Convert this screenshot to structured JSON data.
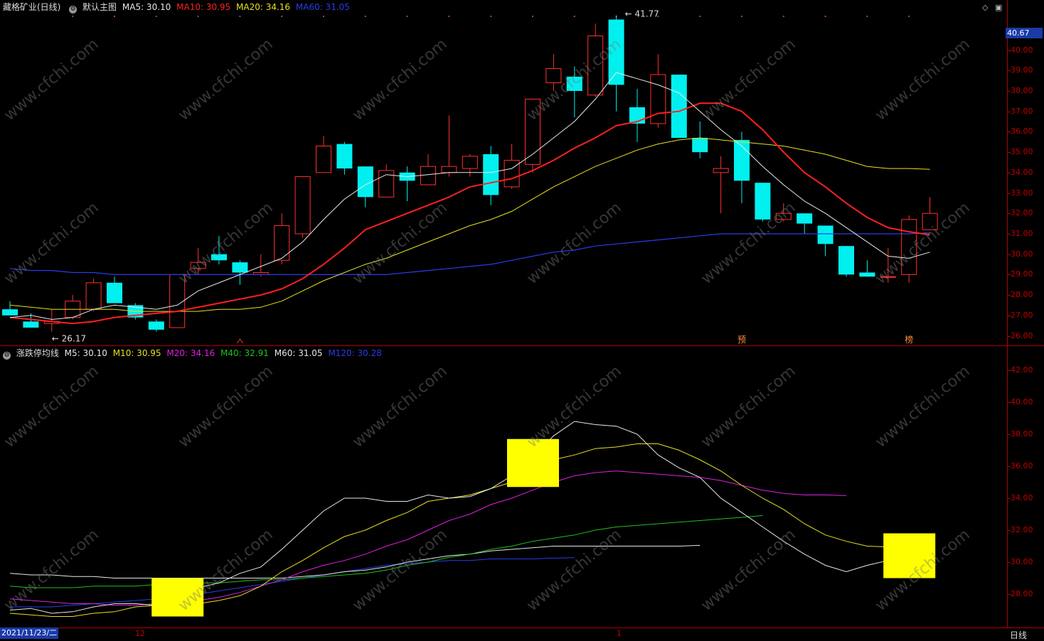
{
  "header_top": {
    "stock": "藏格矿业(日线)",
    "main_label": "默认主图",
    "ma5": "MA5: 30.10",
    "ma10": "MA10: 30.95",
    "ma20": "MA20: 34.16",
    "ma60": "MA60: 31.05"
  },
  "header_bottom": {
    "indicator": "涨跌停均线",
    "m5": "M5: 30.10",
    "m10": "M10: 30.95",
    "m20": "M20: 34.16",
    "m40": "M40: 32.91",
    "m60": "M60: 31.05",
    "m120": "M120: 30.28"
  },
  "colors": {
    "ma5": "#e8e8e8",
    "ma10": "#ff2020",
    "ma20": "#e8e020",
    "ma60": "#2a3ce8",
    "m5": "#e8e8e8",
    "m10": "#e8e020",
    "m20": "#e020e0",
    "m40": "#20c020",
    "m60": "#e8e8e8",
    "m120": "#2a3ce8",
    "up": "#ff3030",
    "down": "#00f0f0",
    "marker": "#ffff00"
  },
  "current_price": "40.67",
  "high_label": "41.77",
  "low_label": "26.17",
  "event_labels": [
    "预",
    "榜"
  ],
  "top_axis_ticks": [
    "40.00",
    "39.00",
    "38.00",
    "37.00",
    "36.00",
    "35.00",
    "34.00",
    "33.00",
    "32.00",
    "31.00",
    "30.00",
    "29.00",
    "28.00",
    "27.00",
    "26.00"
  ],
  "bottom_axis_ticks": [
    "42.00",
    "40.00",
    "38.00",
    "36.00",
    "34.00",
    "32.00",
    "30.00",
    "28.00"
  ],
  "date_bar": {
    "current_date": "2021/11/23/二",
    "month_12": "12",
    "month_1": "1",
    "period": "日线"
  },
  "controls": {
    "diamond": "◇",
    "restore": "▣"
  },
  "watermark": "www.cfchi.com",
  "chart_data": {
    "type": "candlestick",
    "candles": [
      {
        "o": 27.3,
        "h": 27.7,
        "l": 27.0,
        "c": 27.0
      },
      {
        "o": 26.7,
        "h": 27.1,
        "l": 26.4,
        "c": 26.4
      },
      {
        "o": 26.6,
        "h": 27.3,
        "l": 26.2,
        "c": 26.7
      },
      {
        "o": 26.9,
        "h": 28.0,
        "l": 26.8,
        "c": 27.7
      },
      {
        "o": 27.3,
        "h": 28.8,
        "l": 27.2,
        "c": 28.6
      },
      {
        "o": 28.6,
        "h": 28.9,
        "l": 27.6,
        "c": 27.6
      },
      {
        "o": 27.5,
        "h": 27.6,
        "l": 26.8,
        "c": 26.9
      },
      {
        "o": 26.7,
        "h": 26.8,
        "l": 26.2,
        "c": 26.3
      },
      {
        "o": 26.4,
        "h": 29.0,
        "l": 26.4,
        "c": 29.0
      },
      {
        "o": 29.3,
        "h": 30.3,
        "l": 29.0,
        "c": 29.6
      },
      {
        "o": 30.0,
        "h": 30.9,
        "l": 29.5,
        "c": 29.7
      },
      {
        "o": 29.6,
        "h": 29.7,
        "l": 28.5,
        "c": 29.1
      },
      {
        "o": 29.0,
        "h": 30.0,
        "l": 28.9,
        "c": 29.1
      },
      {
        "o": 29.7,
        "h": 32.0,
        "l": 29.5,
        "c": 31.4
      },
      {
        "o": 31.0,
        "h": 33.8,
        "l": 30.8,
        "c": 33.8
      },
      {
        "o": 34.0,
        "h": 35.8,
        "l": 34.0,
        "c": 35.3
      },
      {
        "o": 35.4,
        "h": 35.5,
        "l": 33.9,
        "c": 34.2
      },
      {
        "o": 34.3,
        "h": 34.3,
        "l": 32.3,
        "c": 32.8
      },
      {
        "o": 32.8,
        "h": 34.4,
        "l": 32.8,
        "c": 34.1
      },
      {
        "o": 34.0,
        "h": 34.3,
        "l": 32.6,
        "c": 33.6
      },
      {
        "o": 33.4,
        "h": 34.9,
        "l": 33.4,
        "c": 34.3
      },
      {
        "o": 34.0,
        "h": 36.8,
        "l": 33.8,
        "c": 34.3
      },
      {
        "o": 34.2,
        "h": 34.9,
        "l": 33.8,
        "c": 34.8
      },
      {
        "o": 34.9,
        "h": 35.3,
        "l": 32.4,
        "c": 32.9
      },
      {
        "o": 33.3,
        "h": 35.4,
        "l": 33.2,
        "c": 34.6
      },
      {
        "o": 34.4,
        "h": 37.4,
        "l": 34.0,
        "c": 37.6
      },
      {
        "o": 38.4,
        "h": 39.8,
        "l": 38.0,
        "c": 39.1
      },
      {
        "o": 38.7,
        "h": 39.2,
        "l": 36.7,
        "c": 38.0
      },
      {
        "o": 37.8,
        "h": 41.3,
        "l": 37.7,
        "c": 40.7
      },
      {
        "o": 41.5,
        "h": 41.7,
        "l": 37.0,
        "c": 38.3
      },
      {
        "o": 37.2,
        "h": 38.1,
        "l": 35.5,
        "c": 36.4
      },
      {
        "o": 36.4,
        "h": 39.8,
        "l": 36.2,
        "c": 38.8
      },
      {
        "o": 38.8,
        "h": 38.8,
        "l": 35.7,
        "c": 35.7
      },
      {
        "o": 35.7,
        "h": 36.5,
        "l": 34.7,
        "c": 35.0
      },
      {
        "o": 34.0,
        "h": 34.8,
        "l": 32.0,
        "c": 34.2
      },
      {
        "o": 35.6,
        "h": 36.0,
        "l": 32.5,
        "c": 33.6
      },
      {
        "o": 33.5,
        "h": 33.5,
        "l": 31.6,
        "c": 31.7
      },
      {
        "o": 31.7,
        "h": 32.5,
        "l": 31.6,
        "c": 32.0
      },
      {
        "o": 32.0,
        "h": 32.0,
        "l": 31.0,
        "c": 31.5
      },
      {
        "o": 31.4,
        "h": 31.4,
        "l": 29.9,
        "c": 30.5
      },
      {
        "o": 30.4,
        "h": 30.4,
        "l": 28.9,
        "c": 29.0
      },
      {
        "o": 29.1,
        "h": 29.7,
        "l": 28.9,
        "c": 28.9
      },
      {
        "o": 28.9,
        "h": 30.3,
        "l": 28.6,
        "c": 28.9
      },
      {
        "o": 29.0,
        "h": 31.9,
        "l": 28.6,
        "c": 31.7
      },
      {
        "o": 31.2,
        "h": 32.8,
        "l": 31.2,
        "c": 32.0
      }
    ],
    "ma5_line": [
      26.9,
      27.0,
      26.8,
      26.9,
      27.3,
      27.5,
      27.4,
      27.3,
      27.5,
      28.2,
      28.6,
      29.0,
      29.4,
      29.8,
      30.6,
      31.7,
      32.7,
      33.4,
      33.9,
      33.8,
      33.9,
      34.0,
      34.0,
      34.0,
      34.2,
      34.9,
      35.7,
      36.5,
      37.6,
      38.9,
      38.6,
      38.3,
      37.9,
      37.0,
      36.1,
      35.3,
      34.3,
      33.4,
      32.6,
      32.0,
      31.3,
      30.6,
      29.9,
      29.8,
      30.1
    ],
    "ma10_line": [
      26.9,
      26.8,
      26.7,
      26.6,
      26.7,
      26.9,
      27.0,
      27.1,
      27.2,
      27.4,
      27.6,
      27.8,
      28.0,
      28.3,
      28.8,
      29.5,
      30.3,
      31.2,
      31.6,
      32.0,
      32.4,
      32.8,
      33.3,
      33.5,
      33.7,
      34.1,
      34.6,
      35.2,
      35.7,
      36.3,
      36.5,
      36.9,
      37.0,
      37.4,
      37.4,
      37.0,
      36.1,
      35.0,
      34.0,
      33.3,
      32.5,
      31.8,
      31.3,
      31.1,
      30.95
    ],
    "ma20_line": [
      27.5,
      27.4,
      27.3,
      27.3,
      27.3,
      27.3,
      27.2,
      27.2,
      27.2,
      27.2,
      27.3,
      27.3,
      27.4,
      27.7,
      28.2,
      28.7,
      29.1,
      29.5,
      29.8,
      30.2,
      30.6,
      31.0,
      31.4,
      31.7,
      32.1,
      32.7,
      33.3,
      33.8,
      34.3,
      34.7,
      35.1,
      35.4,
      35.6,
      35.7,
      35.6,
      35.5,
      35.4,
      35.3,
      35.1,
      34.9,
      34.6,
      34.3,
      34.2,
      34.2,
      34.16
    ],
    "ma60_line": [
      29.3,
      29.2,
      29.2,
      29.1,
      29.1,
      29.0,
      29.0,
      29.0,
      29.0,
      29.0,
      29.0,
      29.0,
      29.0,
      29.0,
      29.0,
      29.0,
      29.0,
      29.0,
      29.0,
      29.1,
      29.2,
      29.3,
      29.4,
      29.5,
      29.7,
      29.9,
      30.1,
      30.2,
      30.4,
      30.5,
      30.6,
      30.7,
      30.8,
      30.9,
      31.0,
      31.0,
      31.0,
      31.0,
      31.0,
      31.0,
      31.0,
      31.0,
      31.0,
      31.0,
      31.05
    ],
    "bottom_lines": {
      "m5": [
        27.0,
        27.1,
        26.8,
        26.9,
        27.2,
        27.4,
        27.4,
        27.3,
        27.4,
        28.4,
        28.7,
        29.3,
        29.7,
        30.8,
        32.0,
        33.2,
        34.0,
        34.0,
        33.8,
        33.8,
        34.2,
        34.0,
        34.1,
        34.6,
        35.4,
        36.6,
        37.9,
        38.8,
        38.6,
        38.5,
        38.0,
        36.7,
        35.9,
        35.3,
        34.0,
        33.1,
        32.2,
        31.3,
        30.5,
        29.8,
        29.4,
        29.8,
        30.1
      ],
      "m10": [
        26.8,
        26.7,
        26.6,
        26.6,
        26.8,
        26.9,
        27.2,
        27.3,
        27.3,
        27.4,
        27.6,
        27.9,
        28.5,
        29.4,
        30.1,
        30.9,
        31.6,
        32.0,
        32.6,
        33.1,
        33.8,
        34.0,
        34.2,
        34.6,
        35.0,
        35.8,
        36.4,
        36.7,
        37.1,
        37.2,
        37.4,
        37.4,
        37.0,
        36.4,
        35.7,
        34.8,
        34.0,
        33.3,
        32.4,
        31.7,
        31.3,
        31.0,
        30.95
      ],
      "m20": [
        27.7,
        27.6,
        27.5,
        27.4,
        27.4,
        27.3,
        27.3,
        27.4,
        27.5,
        27.6,
        27.8,
        28.1,
        28.5,
        28.9,
        29.4,
        29.8,
        30.1,
        30.5,
        31.0,
        31.4,
        32.0,
        32.6,
        33.0,
        33.6,
        34.0,
        34.5,
        35.0,
        35.4,
        35.6,
        35.7,
        35.6,
        35.5,
        35.4,
        35.3,
        35.1,
        34.8,
        34.5,
        34.3,
        34.2,
        34.2,
        34.16
      ],
      "m40": [
        28.5,
        28.4,
        28.4,
        28.4,
        28.5,
        28.5,
        28.5,
        28.6,
        28.6,
        28.7,
        28.7,
        28.8,
        28.9,
        28.9,
        29.0,
        29.1,
        29.2,
        29.3,
        29.5,
        29.8,
        30.0,
        30.3,
        30.5,
        30.8,
        31.0,
        31.3,
        31.5,
        31.7,
        32.0,
        32.2,
        32.3,
        32.4,
        32.5,
        32.6,
        32.7,
        32.8,
        32.91
      ],
      "m60": [
        29.3,
        29.2,
        29.2,
        29.1,
        29.1,
        29.0,
        29.0,
        29.0,
        29.0,
        29.0,
        29.0,
        29.0,
        29.0,
        29.0,
        29.1,
        29.2,
        29.4,
        29.5,
        29.7,
        30.0,
        30.2,
        30.4,
        30.5,
        30.7,
        30.8,
        30.9,
        31.0,
        31.0,
        31.0,
        31.0,
        31.0,
        31.0,
        31.0,
        31.05
      ],
      "m120": [
        27.2,
        27.2,
        27.2,
        27.3,
        27.4,
        27.5,
        27.6,
        27.7,
        27.8,
        28.0,
        28.2,
        28.4,
        28.6,
        28.8,
        29.0,
        29.2,
        29.4,
        29.6,
        29.8,
        29.9,
        30.0,
        30.1,
        30.1,
        30.2,
        30.2,
        30.2,
        30.25,
        30.28
      ]
    },
    "limit_markers": [
      {
        "label": "",
        "idx": 8,
        "low": 26.6,
        "high": 29.0
      },
      {
        "label": "",
        "idx": 25,
        "low": 34.7,
        "high": 37.7
      },
      {
        "label": "",
        "idx": 43,
        "low": 29.0,
        "high": 31.8
      }
    ],
    "top_ylim": [
      25.6,
      41.9
    ],
    "bottom_ylim": [
      26.0,
      42.8
    ]
  }
}
